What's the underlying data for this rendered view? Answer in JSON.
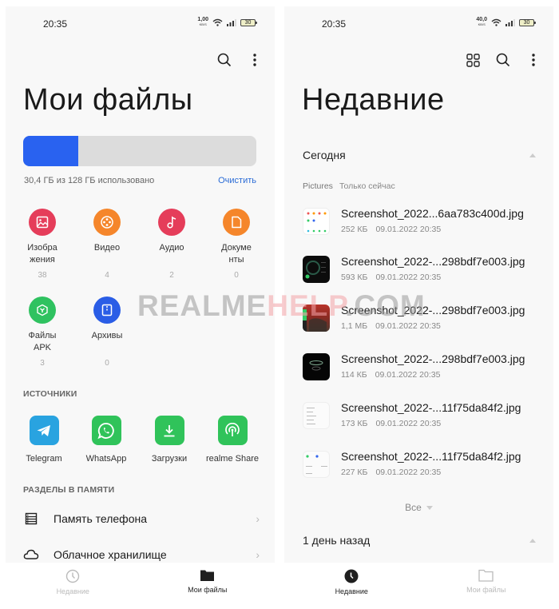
{
  "left": {
    "status": {
      "time": "20:35",
      "net_speed": "1,00",
      "net_unit": "KB/S",
      "battery": "30"
    },
    "toolbar": {
      "search_icon": "search-icon",
      "more_icon": "more-vertical-icon"
    },
    "title": "Мои файлы",
    "storage": {
      "used_fraction": 0.2375,
      "used_text": "30,4 ГБ из 128 ГБ использовано",
      "clean_label": "Очистить",
      "fill_color": "#2962f0"
    },
    "categories": [
      {
        "label": "Изобра\nжения",
        "count": "38",
        "icon": "image-icon",
        "color": "#e53d5a"
      },
      {
        "label": "Видео",
        "count": "4",
        "icon": "film-reel-icon",
        "color": "#f5862b"
      },
      {
        "label": "Аудио",
        "count": "2",
        "icon": "music-note-icon",
        "color": "#e53d5a"
      },
      {
        "label": "Докуме\nнты",
        "count": "0",
        "icon": "document-icon",
        "color": "#f5862b"
      },
      {
        "label": "Файлы\nAPK",
        "count": "3",
        "icon": "apk-package-icon",
        "color": "#2fc260"
      },
      {
        "label": "Архивы",
        "count": "0",
        "icon": "archive-icon",
        "color": "#2a5de6"
      }
    ],
    "sources_heading": "ИСТОЧНИКИ",
    "sources": [
      {
        "label": "Telegram",
        "icon": "telegram-icon",
        "color": "#29a3e0"
      },
      {
        "label": "WhatsApp",
        "icon": "whatsapp-icon",
        "color": "#30c35a"
      },
      {
        "label": "Загрузки",
        "icon": "download-icon",
        "color": "#30c35a"
      },
      {
        "label": "realme Share",
        "icon": "wireless-share-icon",
        "color": "#30c35a"
      }
    ],
    "memory_heading": "РАЗДЕЛЫ В ПАМЯТИ",
    "memory": [
      {
        "label": "Память телефона",
        "icon": "phone-storage-icon"
      },
      {
        "label": "Облачное хранилище",
        "icon": "cloud-icon"
      }
    ],
    "nav": [
      {
        "label": "Недавние",
        "icon": "clock-icon",
        "active": false
      },
      {
        "label": "Мои файлы",
        "icon": "folder-icon",
        "active": true
      }
    ]
  },
  "right": {
    "status": {
      "time": "20:35",
      "net_speed": "40,0",
      "net_unit": "KB/S",
      "battery": "30"
    },
    "toolbar": {
      "grid_icon": "grid-view-icon",
      "search_icon": "search-icon",
      "more_icon": "more-vertical-icon"
    },
    "title": "Недавние",
    "today_group": "Сегодня",
    "meta": {
      "folder": "Pictures",
      "when": "Только сейчас"
    },
    "files": [
      {
        "name": "Screenshot_2022...6aa783c400d.jpg",
        "size": "252 КБ",
        "date": "09.01.2022 20:35",
        "thumb": "light-grid"
      },
      {
        "name": "Screenshot_2022-...298bdf7e003.jpg",
        "size": "593 КБ",
        "date": "09.01.2022 20:35",
        "thumb": "dark-dial"
      },
      {
        "name": "Screenshot_2022-...298bdf7e003.jpg",
        "size": "1,1 МБ",
        "date": "09.01.2022 20:35",
        "thumb": "game-red"
      },
      {
        "name": "Screenshot_2022-...298bdf7e003.jpg",
        "size": "114 КБ",
        "date": "09.01.2022 20:35",
        "thumb": "dark-ring"
      },
      {
        "name": "Screenshot_2022-...11f75da84f2.jpg",
        "size": "173 КБ",
        "date": "09.01.2022 20:35",
        "thumb": "light-list"
      },
      {
        "name": "Screenshot_2022-...11f75da84f2.jpg",
        "size": "227 КБ",
        "date": "09.01.2022 20:35",
        "thumb": "light-dots"
      }
    ],
    "all_label": "Все",
    "yesterday_group": "1 день назад",
    "nav": [
      {
        "label": "Недавние",
        "icon": "clock-icon",
        "active": true
      },
      {
        "label": "Мои файлы",
        "icon": "folder-icon",
        "active": false
      }
    ]
  },
  "watermark": {
    "part1": "REALME",
    "part2": "HELP",
    "part3": ".COM"
  }
}
